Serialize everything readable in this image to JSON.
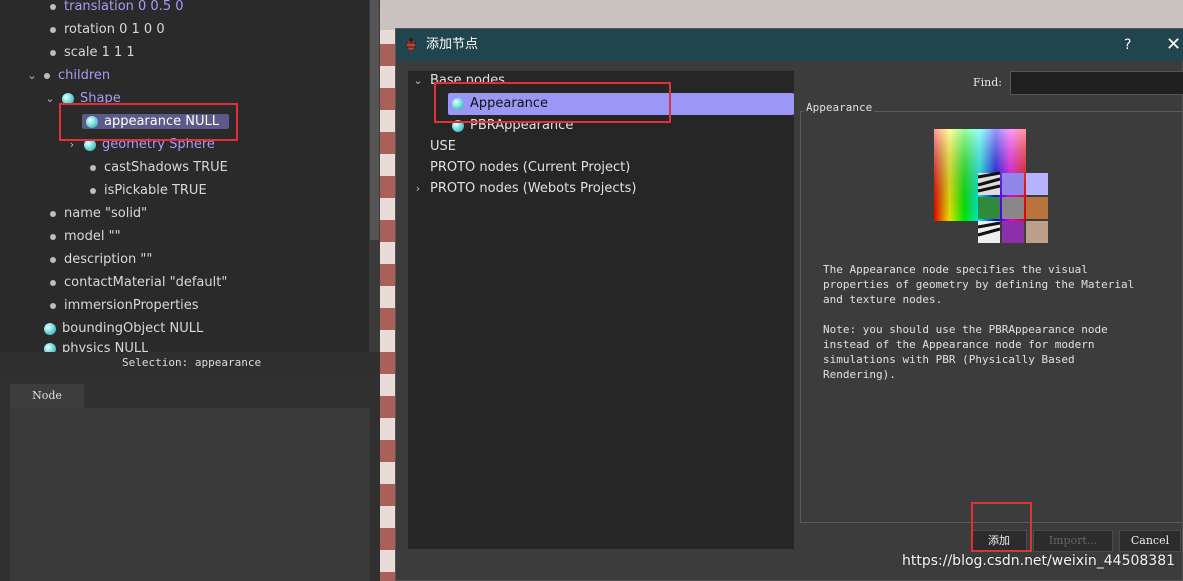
{
  "scene_tree": {
    "items": [
      {
        "label": "translation 0 0.5 0",
        "icon": "dot",
        "purple": true
      },
      {
        "label": "rotation 0 1 0 0",
        "icon": "dot"
      },
      {
        "label": "scale 1 1 1",
        "icon": "dot"
      },
      {
        "label": "children",
        "icon": "dot",
        "purple": true,
        "expander": "v"
      },
      {
        "label": "Shape",
        "icon": "ball",
        "purple": true,
        "expander": "v"
      },
      {
        "label": "appearance NULL",
        "icon": "ball",
        "selected": true
      },
      {
        "label": "geometry Sphere",
        "icon": "ball",
        "purple": true,
        "expander": ">"
      },
      {
        "label": "castShadows TRUE",
        "icon": "dot"
      },
      {
        "label": "isPickable TRUE",
        "icon": "dot"
      },
      {
        "label": "name \"solid\"",
        "icon": "dot"
      },
      {
        "label": "model \"\"",
        "icon": "dot"
      },
      {
        "label": "description \"\"",
        "icon": "dot"
      },
      {
        "label": "contactMaterial \"default\"",
        "icon": "dot"
      },
      {
        "label": "immersionProperties",
        "icon": "dot"
      },
      {
        "label": "boundingObject NULL",
        "icon": "ball"
      },
      {
        "label": "physics NULL",
        "icon": "ball"
      }
    ]
  },
  "selection_label": "Selection: appearance",
  "node_tab": "Node",
  "dialog": {
    "title": "添加节点",
    "help": "?",
    "close": "✕",
    "tree": {
      "base_nodes": "Base nodes",
      "appearance": "Appearance",
      "pbr_appearance": "PBRAppearance",
      "use": "USE",
      "proto_current": "PROTO nodes (Current Project)",
      "proto_webots": "PROTO nodes (Webots Projects)"
    },
    "find_label": "Find:",
    "find_value": "",
    "group_title": "Appearance",
    "description": "The Appearance node specifies the visual\nproperties of geometry by defining the Material\nand texture nodes.\n\nNote: you should use the PBRAppearance node\ninstead of the Appearance node for modern\nsimulations with PBR (Physically Based\nRendering).",
    "buttons": {
      "add": "添加",
      "import": "Import...",
      "cancel": "Cancel"
    }
  },
  "watermark": "https://blog.csdn.net/weixin_44508381",
  "colors": {
    "selection": "#9b97f7",
    "highlight_box": "#e0313b",
    "title_bar": "#20454f"
  }
}
